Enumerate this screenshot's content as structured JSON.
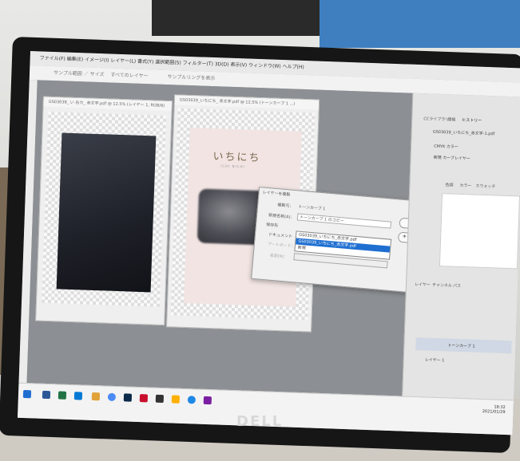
{
  "menu": {
    "text": "ファイル(F)  編集(E)  イメージ(I)  レイヤー(L)  書式(Y)  選択範囲(S)  フィルター(T)  3D(D)  表示(V)  ウィンドウ(W)  ヘルプ(H)"
  },
  "options": {
    "text": "サンプル範囲 ／ サイズ   　すべてのレイヤー　　　　サンプルリングを表示"
  },
  "documents": [
    {
      "tab": "GS03039_ い 右カ_ 赤文字.pdf @ 12.5% (レイヤー 1, RGB/8)"
    },
    {
      "tab": "GS03039_いちにち_ 赤文字.pdf @ 12.5% (トーンカーブ 1 ...)"
    }
  ],
  "card": {
    "title": "いちにち",
    "subtitle": "ICHI  NICHI"
  },
  "dialog": {
    "title": "レイヤーを複製",
    "dup_label": "複製元：",
    "dup_value": "トーンカーブ 1",
    "name_label": "新規名称(A)：",
    "name_value": "トーンカーブ 1 のコピー",
    "dest_label": "保存先",
    "doc_label": "ドキュメント",
    "artboard_label": "アートボード：",
    "newname_label": "名前(N)：",
    "ok": "OK",
    "cancel": "キャンセル",
    "dropdown_selected": "GS03039_いちにち_赤文字.pdf",
    "dropdown_items": [
      "GS03039_いちにち_赤文字.pdf",
      "新規"
    ]
  },
  "panels": {
    "history_tabs": [
      "CCライブラリ",
      "情報",
      "ヒストリー"
    ],
    "history_items": [
      "GS03039_いちにち_赤文字-1.pdf",
      "CMYK カラー",
      "新規 カーブレイヤー"
    ],
    "adjust_tabs": [
      "色調",
      "カラー",
      "スウォッチ"
    ],
    "layer_tabs": [
      "レイヤー",
      "チャンネル",
      "パス"
    ],
    "layers": [
      "トーンカーブ 1",
      "レイヤー 1"
    ]
  },
  "clock": {
    "time": "18:32",
    "date": "2021/01/29"
  },
  "brand": "DELL",
  "colors": {
    "screen_bg": "#8c8f93",
    "selection": "#1f6fd1",
    "card": "#f1e4e2"
  }
}
